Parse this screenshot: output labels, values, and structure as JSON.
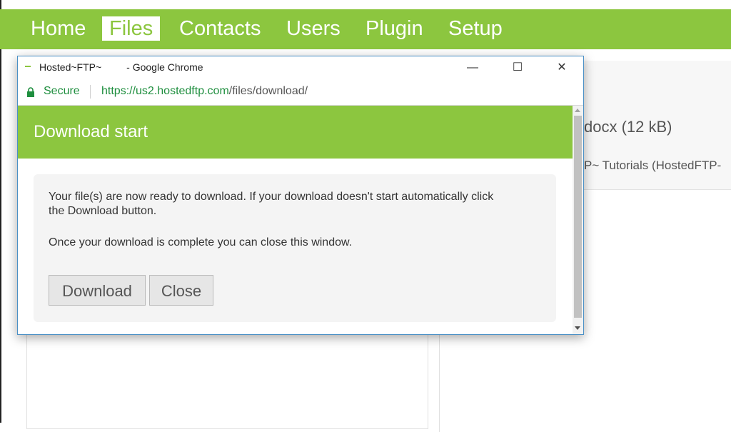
{
  "nav": {
    "items": [
      {
        "label": "Home",
        "active": false
      },
      {
        "label": "Files",
        "active": true
      },
      {
        "label": "Contacts",
        "active": false
      },
      {
        "label": "Users",
        "active": false
      },
      {
        "label": "Plugin",
        "active": false
      },
      {
        "label": "Setup",
        "active": false
      }
    ]
  },
  "background": {
    "file_title": "docx (12 kB)",
    "file_folder": "P~ Tutorials (HostedFTP-"
  },
  "popup": {
    "window_title": "Hosted~FTP~         - Google Chrome",
    "minimize_glyph": "—",
    "maximize_glyph": "☐",
    "close_glyph": "✕",
    "secure_label": "Secure",
    "url_scheme_host": "https://us2.hostedftp.com",
    "url_path": "/files/download/",
    "dialog_title": "Download start",
    "message_line1": "Your file(s) are now ready to download. If your download doesn't start automatically click the Download button.",
    "message_line2": "Once your download is complete you can close this window.",
    "download_button": "Download",
    "close_button": "Close"
  },
  "colors": {
    "brand_green": "#8cc63f",
    "secure_green": "#1e8e3e",
    "window_border": "#4a90c6"
  },
  "icons": {
    "app": "hostedftp-app-icon",
    "lock": "lock-icon"
  }
}
